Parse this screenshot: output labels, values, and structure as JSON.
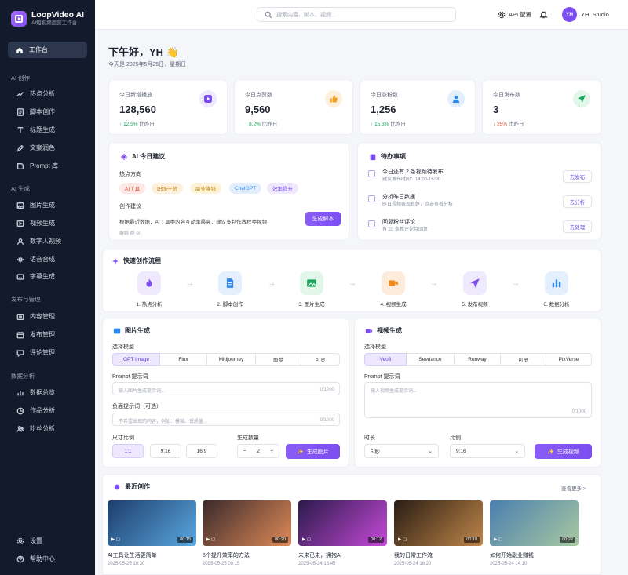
{
  "brand": {
    "name": "LoopVideo AI",
    "subtitle": "AI短视频运营工作台"
  },
  "nav": {
    "active": "工作台",
    "groups": [
      {
        "title": "AI 创作",
        "items": [
          "热点分析",
          "脚本创作",
          "标题生成",
          "文案润色",
          "Prompt 库"
        ]
      },
      {
        "title": "AI 生成",
        "items": [
          "图片生成",
          "视频生成",
          "数字人视频",
          "语音合成",
          "字幕生成"
        ]
      },
      {
        "title": "发布与管理",
        "items": [
          "内容管理",
          "发布管理",
          "评论管理"
        ]
      },
      {
        "title": "数据分析",
        "items": [
          "数据总览",
          "作品分析",
          "粉丝分析"
        ]
      }
    ],
    "bottom": [
      "设置",
      "帮助中心"
    ]
  },
  "topbar": {
    "search_placeholder": "搜索内容、脚本、视频...",
    "api": "API 配置",
    "avatar": "YH",
    "user": "YH: Studio"
  },
  "header": {
    "greeting": "下午好，YH 👋",
    "date": "今天是 2025年5月25日，星期日"
  },
  "stats": [
    {
      "label": "今日新增播放",
      "value": "128,560",
      "delta": "12.5%",
      "dir": "up",
      "suffix": "比昨日",
      "color": "#7c4df0",
      "bg": "#efe9fd"
    },
    {
      "label": "今日点赞数",
      "value": "9,560",
      "delta": "8.2%",
      "dir": "up",
      "suffix": "比昨日",
      "color": "#f59e1b",
      "bg": "#fdf1dd"
    },
    {
      "label": "今日涨粉数",
      "value": "1,256",
      "delta": "15.3%",
      "dir": "up",
      "suffix": "比昨日",
      "color": "#2f86eb",
      "bg": "#e3effd"
    },
    {
      "label": "今日发布数",
      "value": "3",
      "delta": "25%",
      "dir": "down",
      "suffix": "比昨日",
      "color": "#19a55a",
      "bg": "#e2f6ea"
    }
  ],
  "ai_suggest": {
    "title": "AI 今日建议",
    "hot_label": "热点方向",
    "tags": [
      "AI工具",
      "职场干货",
      "副业赚钱",
      "ChatGPT",
      "效率提升"
    ],
    "create_label": "创作建议",
    "text": "根据最近数据，AI工具类内容互动率最高，建议多制作教程类视频",
    "sub": "群聊 群 ol",
    "button": "生成脚本"
  },
  "todos": {
    "title": "待办事项",
    "items": [
      {
        "title": "今日还有 2 条视频待发布",
        "sub": "建议发布时间：14:00-16:00",
        "action": "去发布"
      },
      {
        "title": "分析昨日数据",
        "sub": "昨日视频表现良好，点击查看分析",
        "action": "去分析"
      },
      {
        "title": "回复粉丝评论",
        "sub": "有 23 条新评论待回复",
        "action": "去处理"
      }
    ]
  },
  "flow": {
    "title": "快速创作流程",
    "steps": [
      {
        "label": "1. 热点分析",
        "icon": "flame-icon",
        "color": "#7c4df0",
        "bg": "#efe9fd"
      },
      {
        "label": "2. 脚本创作",
        "icon": "document-icon",
        "color": "#2f86eb",
        "bg": "#e3effd"
      },
      {
        "label": "3. 图片生成",
        "icon": "image-icon",
        "color": "#19a55a",
        "bg": "#e2f6ea"
      },
      {
        "label": "4. 视频生成",
        "icon": "video-icon",
        "color": "#f08a1b",
        "bg": "#fdecdc"
      },
      {
        "label": "5. 发布视频",
        "icon": "send-icon",
        "color": "#7c4df0",
        "bg": "#efe9fd"
      },
      {
        "label": "6. 数据分析",
        "icon": "chart-icon",
        "color": "#2f86eb",
        "bg": "#e3effd"
      }
    ]
  },
  "image_gen": {
    "title": "图片生成",
    "model_label": "选择模型",
    "models": [
      "GPT Image",
      "Flux",
      "Midjourney",
      "即梦",
      "可灵"
    ],
    "selected": 0,
    "prompt_label": "Prompt 提示词",
    "prompt_placeholder": "输入图片生成提示词...",
    "prompt_count": "0/1000",
    "neg_label": "负面提示词（可选）",
    "neg_placeholder": "不希望出现的内容，例如：模糊、低质量...",
    "neg_count": "0/1000",
    "ratio_label": "尺寸比例",
    "ratios": [
      "1:1",
      "9:16",
      "16:9"
    ],
    "ratio_selected": 0,
    "qty_label": "生成数量",
    "qty": "2",
    "button": "生成图片"
  },
  "video_gen": {
    "title": "视频生成",
    "model_label": "选择模型",
    "models": [
      "Veo3",
      "Seedance",
      "Runway",
      "可灵",
      "PixVerse"
    ],
    "selected": 0,
    "prompt_label": "Prompt 提示词",
    "prompt_placeholder": "输入视频生成提示词...",
    "prompt_count": "0/1000",
    "duration_label": "时长",
    "duration": "5 秒",
    "ratio_label": "比例",
    "ratio": "9:16",
    "button": "生成视频"
  },
  "recent": {
    "title": "最近创作",
    "more": "查看更多 >",
    "items": [
      {
        "title": "AI工具让生活更简单",
        "date": "2025-05-25 10:30",
        "dur": "00:15",
        "c1": "#1d3d6b",
        "c2": "#5aa8e0"
      },
      {
        "title": "5个提升效率的方法",
        "date": "2025-05-25 09:15",
        "dur": "00:20",
        "c1": "#3a2a2a",
        "c2": "#e08a5a"
      },
      {
        "title": "未来已来，拥抱AI",
        "date": "2025-05-24 18:45",
        "dur": "00:12",
        "c1": "#2a1a4a",
        "c2": "#c64ad8"
      },
      {
        "title": "我的日常工作流",
        "date": "2025-05-24 16:20",
        "dur": "00:18",
        "c1": "#2a1d14",
        "c2": "#c0864a"
      },
      {
        "title": "如何开始副业赚钱",
        "date": "2025-05-24 14:10",
        "dur": "00:22",
        "c1": "#4a7fb0",
        "c2": "#a8c8a0"
      }
    ]
  }
}
